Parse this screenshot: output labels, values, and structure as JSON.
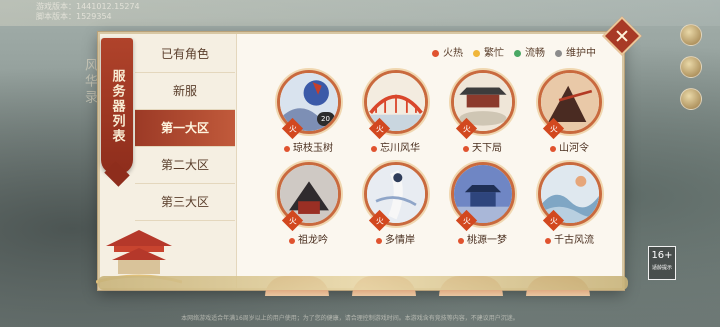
{
  "version_info": {
    "line1": "游戏版本：1441012.15274",
    "line2": "脚本版本：1529354"
  },
  "background_vertical_text": "风华录",
  "panel_title": "服务器列表",
  "menu": {
    "items": [
      {
        "label": "已有角色",
        "active": false
      },
      {
        "label": "新服",
        "active": false
      },
      {
        "label": "第一大区",
        "active": true
      },
      {
        "label": "第二大区",
        "active": false
      },
      {
        "label": "第三大区",
        "active": false
      }
    ]
  },
  "legend": [
    {
      "label": "火热",
      "color": "#e0532f"
    },
    {
      "label": "繁忙",
      "color": "#f0b63a"
    },
    {
      "label": "流畅",
      "color": "#4aa864"
    },
    {
      "label": "维护中",
      "color": "#8c8c8c"
    }
  ],
  "servers": [
    {
      "name": "琼枝玉树",
      "status": "火",
      "level": "20"
    },
    {
      "name": "忘川风华",
      "status": "火"
    },
    {
      "name": "天下局",
      "status": "火"
    },
    {
      "name": "山河令",
      "status": "火"
    },
    {
      "name": "祖龙吟",
      "status": "火"
    },
    {
      "name": "多情岸",
      "status": "火"
    },
    {
      "name": "桃源一梦",
      "status": "火"
    },
    {
      "name": "千古风流",
      "status": "火"
    }
  ],
  "age_rating": {
    "value": "16+",
    "label": "适龄提示"
  },
  "footer": "本网络游戏适合年满16周岁以上的用户使用；为了您的健康，请合理控制游戏时间。本游戏含有竞技等内容，不建议用户沉迷。"
}
